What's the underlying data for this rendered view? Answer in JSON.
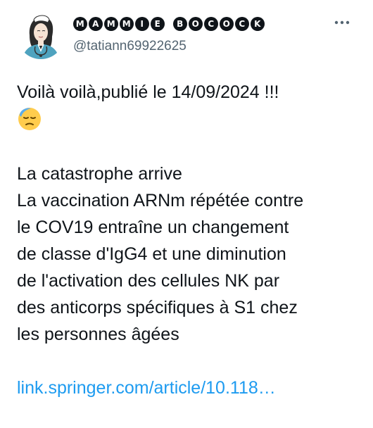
{
  "tweet": {
    "display_name_letters_1": [
      "M",
      "A",
      "M",
      "M",
      "I",
      "E"
    ],
    "display_name_letters_2": [
      "B",
      "O",
      "C",
      "O",
      "C",
      "K"
    ],
    "handle": "@tatiann69922625",
    "more_icon": "ellipsis-icon",
    "avatar_icon": "nurse-avatar-icon",
    "body_lines_1": [
      "Voilà voilà,publié le 14/09/2024 !!!"
    ],
    "emoji": "downcast-face-with-sweat-emoji",
    "body_lines_2": [
      "La catastrophe arrive",
      "La vaccination ARNm répétée contre",
      "le COV19 entraîne un changement",
      "de classe d'IgG4 et une diminution",
      "de l'activation des cellules NK par",
      "des anticorps spécifiques à S1 chez",
      "les personnes âgées"
    ],
    "link_text": "link.springer.com/article/10.118…",
    "colors": {
      "text": "#0f1419",
      "muted": "#536471",
      "link": "#1d9bf0"
    }
  }
}
